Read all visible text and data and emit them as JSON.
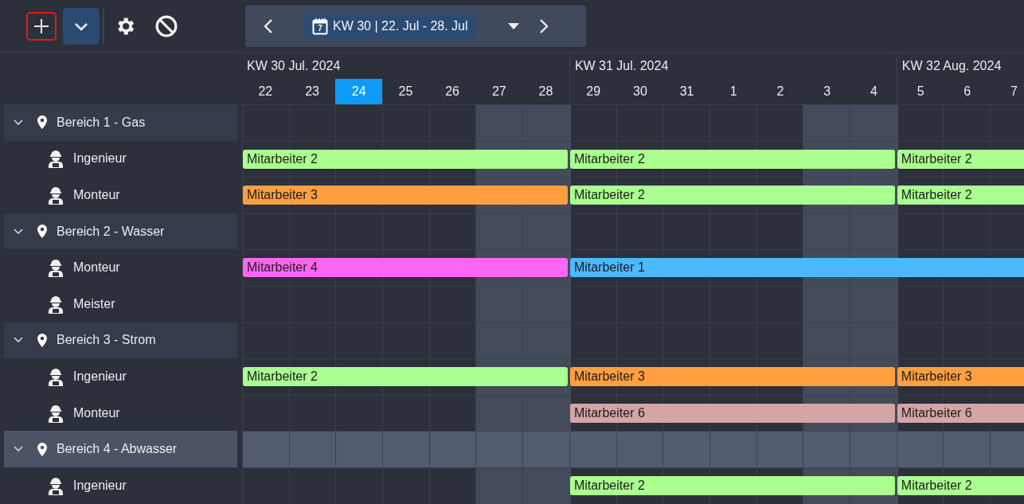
{
  "toolbar": {
    "buttons": [
      {
        "kind": "add",
        "focused": true,
        "selected": false
      },
      {
        "kind": "expand",
        "focused": false,
        "selected": true
      },
      {
        "kind": "settings",
        "focused": false,
        "selected": false
      },
      {
        "kind": "block",
        "focused": false,
        "selected": false
      }
    ]
  },
  "navigator": {
    "calendar_day": "7",
    "week_label": "KW 30 | 22. Jul - 28. Jul"
  },
  "weeks": [
    {
      "label": "KW 30 Jul. 2024",
      "days": [
        {
          "label": "22",
          "weekend": false,
          "today": false
        },
        {
          "label": "23",
          "weekend": false,
          "today": false
        },
        {
          "label": "24",
          "weekend": false,
          "today": true
        },
        {
          "label": "25",
          "weekend": false,
          "today": false
        },
        {
          "label": "26",
          "weekend": false,
          "today": false
        },
        {
          "label": "27",
          "weekend": true,
          "today": false
        },
        {
          "label": "28",
          "weekend": true,
          "today": false
        }
      ]
    },
    {
      "label": "KW 31 Jul. 2024",
      "days": [
        {
          "label": "29",
          "weekend": false,
          "today": false
        },
        {
          "label": "30",
          "weekend": false,
          "today": false
        },
        {
          "label": "31",
          "weekend": false,
          "today": false
        },
        {
          "label": "1",
          "weekend": false,
          "today": false
        },
        {
          "label": "2",
          "weekend": false,
          "today": false
        },
        {
          "label": "3",
          "weekend": true,
          "today": false
        },
        {
          "label": "4",
          "weekend": true,
          "today": false
        }
      ]
    },
    {
      "label": "KW 32 Aug. 2024",
      "days": [
        {
          "label": "5",
          "weekend": false,
          "today": false
        },
        {
          "label": "6",
          "weekend": false,
          "today": false
        },
        {
          "label": "7",
          "weekend": false,
          "today": false
        }
      ]
    }
  ],
  "groups": [
    {
      "name": "Bereich 1 - Gas",
      "expanded": true,
      "selected": false,
      "children": [
        {
          "name": "Ingenieur",
          "bookings": [
            {
              "label": "Mitarbeiter 2",
              "color": "#aaff90",
              "continues": false
            },
            {
              "label": "Mitarbeiter 2",
              "color": "#aaff90",
              "continues": false
            },
            {
              "label": "Mitarbeiter 2",
              "color": "#aaff90",
              "continues": false
            }
          ]
        },
        {
          "name": "Monteur",
          "bookings": [
            {
              "label": "Mitarbeiter 3",
              "color": "#ff9f40",
              "continues": false
            },
            {
              "label": "Mitarbeiter 2",
              "color": "#aaff90",
              "continues": false
            },
            {
              "label": "Mitarbeiter 2",
              "color": "#aaff90",
              "continues": false
            }
          ]
        }
      ]
    },
    {
      "name": "Bereich 2 - Wasser",
      "expanded": true,
      "selected": false,
      "children": [
        {
          "name": "Monteur",
          "bookings": [
            {
              "label": "Mitarbeiter 4",
              "color": "#ff66f5",
              "continues": false
            },
            {
              "label": "Mitarbeiter 1",
              "color": "#4db8ff",
              "continues": true
            }
          ]
        },
        {
          "name": "Meister"
        }
      ]
    },
    {
      "name": "Bereich 3 - Strom",
      "expanded": true,
      "selected": false,
      "children": [
        {
          "name": "Ingenieur",
          "bookings": [
            {
              "label": "Mitarbeiter 2",
              "color": "#aaff90",
              "continues": false
            },
            {
              "label": "Mitarbeiter 3",
              "color": "#ff9f40",
              "continues": false
            },
            {
              "label": "Mitarbeiter 3",
              "color": "#ff9f40",
              "continues": false
            }
          ]
        },
        {
          "name": "Monteur",
          "bookings": [
            {
              "kind": "empty"
            },
            {
              "label": "Mitarbeiter 6",
              "color": "#d4a5a5",
              "continues": false
            },
            {
              "label": "Mitarbeiter 6",
              "color": "#d4a5a5",
              "continues": false
            }
          ]
        }
      ]
    },
    {
      "name": "Bereich 4 - Abwasser",
      "expanded": true,
      "selected": true,
      "children": [
        {
          "name": "Ingenieur",
          "bookings": [
            {
              "kind": "empty"
            },
            {
              "label": "Mitarbeiter 2",
              "color": "#aaff90",
              "continues": false
            },
            {
              "label": "Mitarbeiter 2",
              "color": "#aaff90",
              "continues": false
            }
          ]
        }
      ]
    }
  ]
}
